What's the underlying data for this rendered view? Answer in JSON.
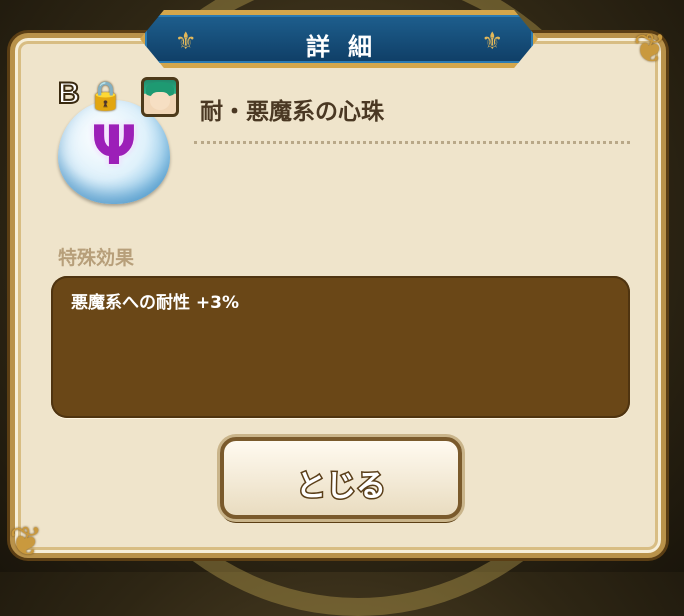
{
  "dialog": {
    "title": "詳細",
    "colors": {
      "banner": "#0f3e66",
      "panel": "#efe4cb",
      "effect_box": "#6a4717",
      "gold": "#d3a64b"
    }
  },
  "item": {
    "rank": "B",
    "name": "耐・悪魔系の心珠",
    "gem_symbol": "Ψ",
    "icons": [
      "lock-icon",
      "character-portrait-icon",
      "trident-icon"
    ]
  },
  "effects": {
    "label": "特殊効果",
    "text": "悪魔系への耐性 +3%"
  },
  "buttons": {
    "close_label": "とじる"
  }
}
